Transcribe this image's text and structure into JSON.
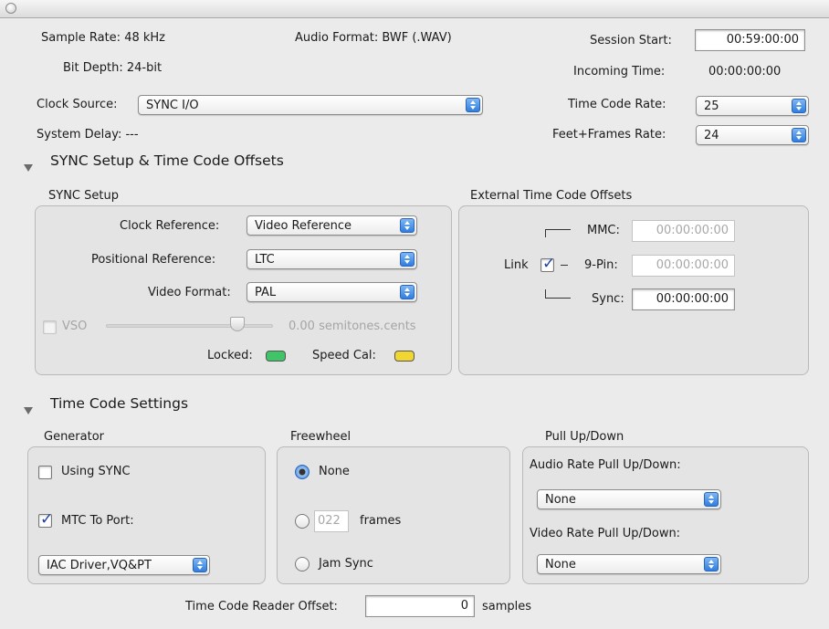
{
  "header": {
    "sample_rate": "Sample Rate: 48 kHz",
    "audio_format": "Audio Format: BWF (.WAV)",
    "session_start_label": "Session Start:",
    "session_start_value": "00:59:00:00",
    "bit_depth": "Bit Depth: 24-bit",
    "incoming_time_label": "Incoming Time:",
    "incoming_time_value": "00:00:00:00",
    "clock_source_label": "Clock Source:",
    "clock_source_value": "SYNC I/O",
    "time_code_rate_label": "Time Code Rate:",
    "time_code_rate_value": "25",
    "system_delay": "System Delay: ---",
    "feet_frames_label": "Feet+Frames Rate:",
    "feet_frames_value": "24"
  },
  "sync_section": {
    "title": "SYNC Setup & Time Code Offsets",
    "setup_group_label": "SYNC Setup",
    "clock_reference_label": "Clock Reference:",
    "clock_reference_value": "Video Reference",
    "positional_reference_label": "Positional Reference:",
    "positional_reference_value": "LTC",
    "video_format_label": "Video Format:",
    "video_format_value": "PAL",
    "vso_label": "VSO",
    "vso_checked": false,
    "vso_level": 0.5,
    "semitones_value": "0.00 semitones.cents",
    "locked_label": "Locked:",
    "speed_cal_label": "Speed Cal:",
    "locked_color": "#3fc468",
    "speed_cal_color": "#f2d630",
    "offsets_group_label": "External Time Code Offsets",
    "mmc_label": "MMC:",
    "mmc_value": "00:00:00:00",
    "ninepin_label": "9-Pin:",
    "ninepin_value": "00:00:00:00",
    "link_label": "Link",
    "link_checked": true,
    "sync_label": "Sync:",
    "sync_value": "00:00:00:00"
  },
  "timecode_section": {
    "title": "Time Code Settings",
    "generator_label": "Generator",
    "using_sync_label": "Using SYNC",
    "using_sync_checked": false,
    "mtc_label": "MTC To Port:",
    "mtc_checked": true,
    "mtc_port_value": "IAC Driver,VQ&PT",
    "freewheel_label": "Freewheel",
    "none_label": "None",
    "frames_value": "022",
    "frames_label": "frames",
    "jam_sync_label": "Jam Sync",
    "pull_label": "Pull Up/Down",
    "audio_pull_label": "Audio Rate Pull Up/Down:",
    "audio_pull_value": "None",
    "video_pull_label": "Video Rate Pull Up/Down:",
    "video_pull_value": "None",
    "reader_offset_label": "Time Code Reader Offset:",
    "reader_offset_value": "0",
    "samples_label": "samples"
  }
}
